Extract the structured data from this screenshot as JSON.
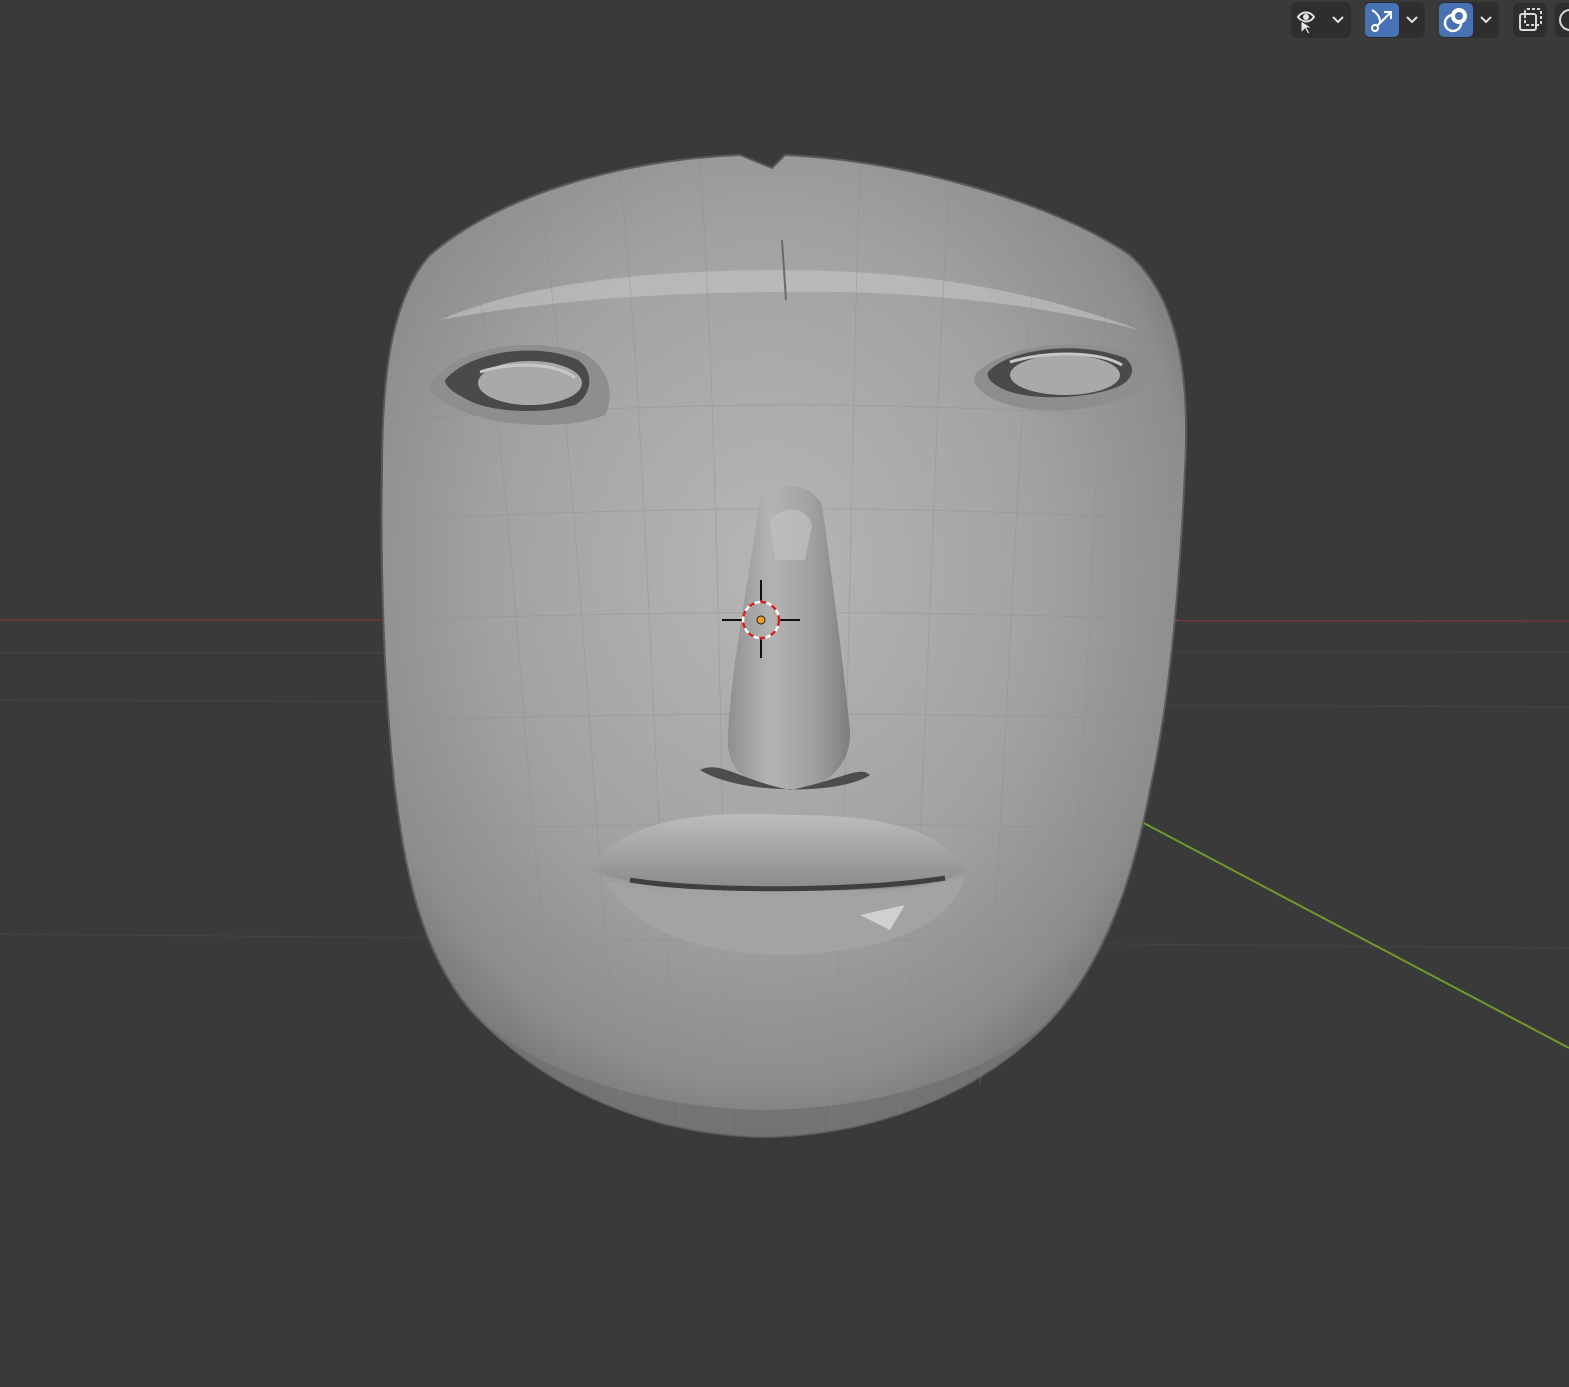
{
  "viewport": {
    "background": "#3a3a3a",
    "mesh_color": "#9c9c9c",
    "x_axis_color": "#7a3b3b",
    "y_axis_color": "#6f9a2b",
    "cursor_colors": [
      "#cc2222",
      "#ffffff"
    ],
    "origin_color": "#f0a020"
  },
  "toolbar": {
    "active_color": "#4772b3",
    "items": [
      {
        "name": "visibility-selectability",
        "icon": "eye-cursor-icon",
        "active": false,
        "has_dropdown": true
      },
      {
        "name": "gizmos",
        "icon": "gizmo-icon",
        "active": true,
        "has_dropdown": true
      },
      {
        "name": "overlays",
        "icon": "overlays-icon",
        "active": true,
        "has_dropdown": true
      },
      {
        "name": "xray",
        "icon": "xray-icon",
        "active": false,
        "has_dropdown": false
      },
      {
        "name": "shading",
        "icon": "wireframe-sphere-icon",
        "active": false,
        "has_dropdown": false
      }
    ]
  }
}
